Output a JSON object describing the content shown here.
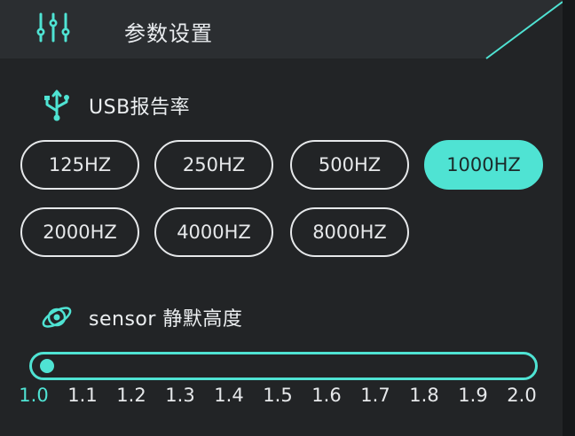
{
  "header": {
    "title": "参数设置",
    "icon": "sliders-icon"
  },
  "usb": {
    "label": "USB报告率",
    "icon": "usb-icon",
    "rates": [
      "125HZ",
      "250HZ",
      "500HZ",
      "1000HZ",
      "2000HZ",
      "4000HZ",
      "8000HZ"
    ],
    "selected": "1000HZ"
  },
  "sensor": {
    "label": "sensor 静默高度",
    "icon": "sensor-icon",
    "value": 1.0,
    "min": 1.0,
    "max": 2.0,
    "ticks": [
      "1.0",
      "1.1",
      "1.2",
      "1.3",
      "1.4",
      "1.5",
      "1.6",
      "1.7",
      "1.8",
      "1.9",
      "2.0"
    ]
  },
  "colors": {
    "accent": "#4fe3d3",
    "background": "#222426",
    "text": "#e6e8ea"
  }
}
